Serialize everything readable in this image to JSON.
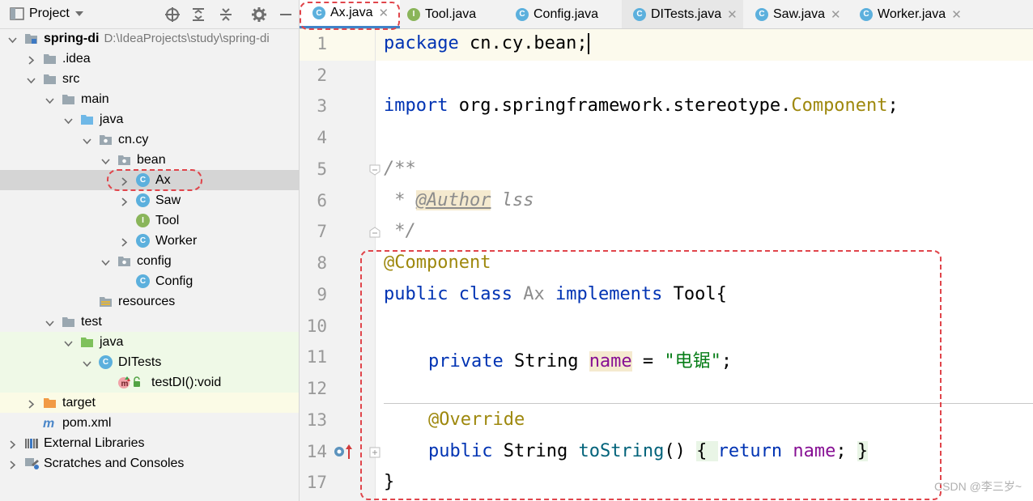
{
  "project_panel": {
    "title": "Project",
    "toolbar_icons": [
      "locate-icon",
      "expand-all-icon",
      "collapse-all-icon",
      "gear-icon",
      "hide-icon"
    ],
    "tree": [
      {
        "label": "spring-di",
        "path": "D:\\IdeaProjects\\study\\spring-di",
        "icon": "module-folder-icon",
        "level": 0,
        "expanded": true,
        "bold": true
      },
      {
        "label": ".idea",
        "icon": "folder-icon",
        "level": 1,
        "expanded": false
      },
      {
        "label": "src",
        "icon": "folder-icon",
        "level": 1,
        "expanded": true
      },
      {
        "label": "main",
        "icon": "folder-icon",
        "level": 2,
        "expanded": true
      },
      {
        "label": "java",
        "icon": "source-folder-icon",
        "level": 3,
        "expanded": true
      },
      {
        "label": "cn.cy",
        "icon": "package-icon",
        "level": 4,
        "expanded": true
      },
      {
        "label": "bean",
        "icon": "package-icon",
        "level": 5,
        "expanded": true
      },
      {
        "label": "Ax",
        "icon": "class-icon",
        "level": 6,
        "expanded": false,
        "selected": true
      },
      {
        "label": "Saw",
        "icon": "class-icon",
        "level": 6,
        "expanded": false
      },
      {
        "label": "Tool",
        "icon": "interface-icon",
        "level": 6,
        "leaf": true
      },
      {
        "label": "Worker",
        "icon": "class-icon",
        "level": 6,
        "expanded": false
      },
      {
        "label": "config",
        "icon": "package-icon",
        "level": 5,
        "expanded": true
      },
      {
        "label": "Config",
        "icon": "class-icon",
        "level": 6,
        "leaf": true
      },
      {
        "label": "resources",
        "icon": "resources-folder-icon",
        "level": 4,
        "leaf": true
      },
      {
        "label": "test",
        "icon": "folder-icon",
        "level": 2,
        "expanded": true
      },
      {
        "label": "java",
        "icon": "test-folder-icon",
        "level": 3,
        "expanded": true,
        "test": true
      },
      {
        "label": "DITests",
        "icon": "test-class-icon",
        "level": 4,
        "expanded": true,
        "test": true
      },
      {
        "label": "testDI():void",
        "icon": "method-icon",
        "level": 5,
        "leaf": true,
        "test": true
      },
      {
        "label": "target",
        "icon": "excluded-folder-icon",
        "level": 1,
        "expanded": false,
        "excluded": true
      },
      {
        "label": "pom.xml",
        "icon": "maven-icon",
        "level": 1,
        "leaf": true
      },
      {
        "label": "External Libraries",
        "icon": "libraries-icon",
        "level": 0,
        "expanded": false
      },
      {
        "label": "Scratches and Consoles",
        "icon": "scratches-icon",
        "level": 0,
        "expanded": false
      }
    ]
  },
  "tabs": [
    {
      "label": "Ax.java",
      "icon": "class-icon",
      "active": true
    },
    {
      "label": "Tool.java",
      "icon": "interface-icon"
    },
    {
      "label": "Config.java",
      "icon": "class-icon"
    },
    {
      "label": "DITests.java",
      "icon": "test-class-icon"
    },
    {
      "label": "Saw.java",
      "icon": "class-icon"
    },
    {
      "label": "Worker.java",
      "icon": "class-icon"
    }
  ],
  "editor": {
    "line_numbers": [
      "1",
      "2",
      "3",
      "4",
      "5",
      "6",
      "7",
      "8",
      "9",
      "10",
      "11",
      "12",
      "13",
      "14",
      "17"
    ],
    "code": {
      "l1_kw": "package",
      "l1_rest": " cn.cy.bean;",
      "l3_kw": "import",
      "l3_rest": " org.springframework.stereotype.",
      "l3_ann": "Component",
      "l3_end": ";",
      "l5": "/**",
      "l6_star": " * ",
      "l6_tag": "@Author",
      "l6_rest": " lss",
      "l7": " */",
      "l8": "@Component",
      "l9_kw1": "public",
      "l9_kw2": "class",
      "l9_name": "Ax",
      "l9_kw3": "implements",
      "l9_rest": " Tool{",
      "l11_kw": "private",
      "l11_type": " String ",
      "l11_field": "name",
      "l11_eq": " = ",
      "l11_str": "\"电锯\"",
      "l11_end": ";",
      "l13": "@Override",
      "l14_kw": "public",
      "l14_type": " String ",
      "l14_method": "toString",
      "l14_paren": "() ",
      "l14_open": "{ ",
      "l14_ret": "return",
      "l14_field": "name",
      "l14_semi": "; ",
      "l14_close": "}",
      "l17": "}"
    }
  },
  "watermark": "CSDN @李三岁~"
}
